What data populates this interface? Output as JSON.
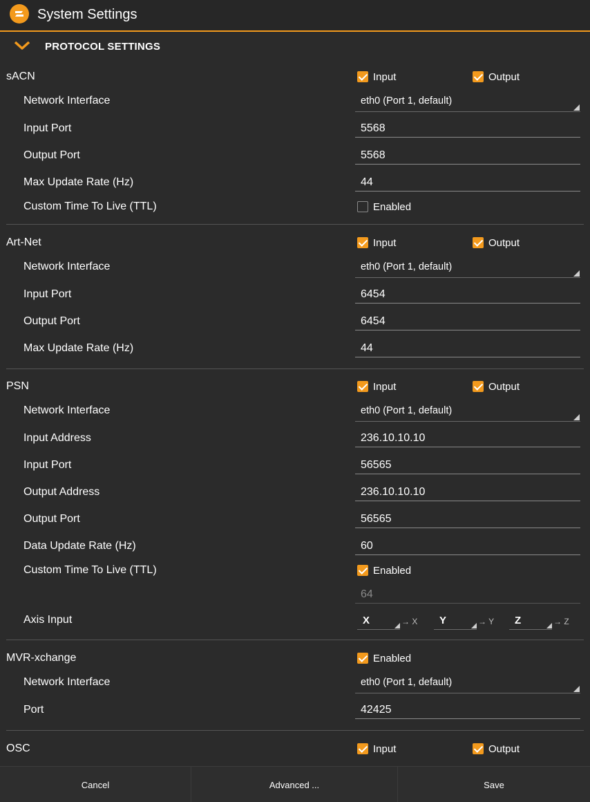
{
  "window": {
    "title": "System Settings"
  },
  "section": {
    "title": "PROTOCOL SETTINGS"
  },
  "sacn": {
    "label": "sACN",
    "input_label": "Input",
    "input_checked": true,
    "output_label": "Output",
    "output_checked": true,
    "network_interface_label": "Network Interface",
    "network_interface_value": "eth0 (Port 1, default)",
    "input_port_label": "Input Port",
    "input_port_value": "5568",
    "output_port_label": "Output Port",
    "output_port_value": "5568",
    "max_rate_label": "Max Update Rate (Hz)",
    "max_rate_value": "44",
    "ttl_label": "Custom Time To Live (TTL)",
    "ttl_enabled_label": "Enabled",
    "ttl_enabled_checked": false
  },
  "artnet": {
    "label": "Art-Net",
    "input_label": "Input",
    "input_checked": true,
    "output_label": "Output",
    "output_checked": true,
    "network_interface_label": "Network Interface",
    "network_interface_value": "eth0 (Port 1, default)",
    "input_port_label": "Input Port",
    "input_port_value": "6454",
    "output_port_label": "Output Port",
    "output_port_value": "6454",
    "max_rate_label": "Max Update Rate (Hz)",
    "max_rate_value": "44"
  },
  "psn": {
    "label": "PSN",
    "input_label": "Input",
    "input_checked": true,
    "output_label": "Output",
    "output_checked": true,
    "network_interface_label": "Network Interface",
    "network_interface_value": "eth0 (Port 1, default)",
    "input_address_label": "Input Address",
    "input_address_value": "236.10.10.10",
    "input_port_label": "Input Port",
    "input_port_value": "56565",
    "output_address_label": "Output Address",
    "output_address_value": "236.10.10.10",
    "output_port_label": "Output Port",
    "output_port_value": "56565",
    "data_rate_label": "Data Update Rate (Hz)",
    "data_rate_value": "60",
    "ttl_label": "Custom Time To Live (TTL)",
    "ttl_enabled_label": "Enabled",
    "ttl_enabled_checked": true,
    "ttl_value": "64",
    "axis_label": "Axis Input",
    "axes": [
      {
        "value": "X",
        "mapping": "→ X"
      },
      {
        "value": "Y",
        "mapping": "→ Y"
      },
      {
        "value": "Z",
        "mapping": "→ Z"
      }
    ]
  },
  "mvr": {
    "label": "MVR-xchange",
    "enabled_label": "Enabled",
    "enabled_checked": true,
    "network_interface_label": "Network Interface",
    "network_interface_value": "eth0 (Port 1, default)",
    "port_label": "Port",
    "port_value": "42425"
  },
  "osc": {
    "label": "OSC",
    "input_label": "Input",
    "input_checked": true,
    "output_label": "Output",
    "output_checked": true
  },
  "footer": {
    "cancel_label": "Cancel",
    "advanced_label": "Advanced ...",
    "save_label": "Save"
  },
  "colors": {
    "accent": "#f39a1d",
    "background": "#2b2b2b",
    "divider": "#555555"
  }
}
